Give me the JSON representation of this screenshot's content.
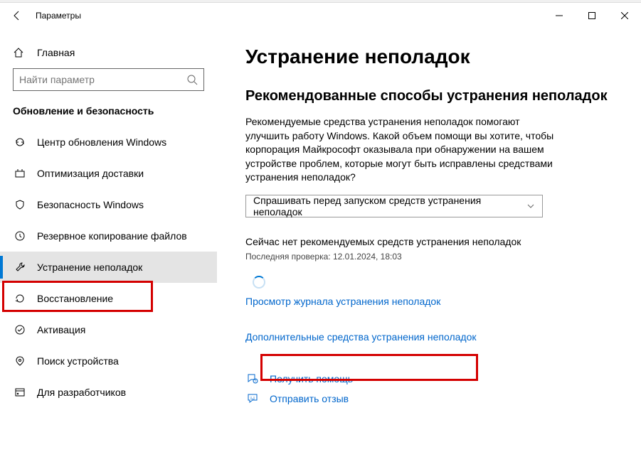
{
  "window": {
    "title": "Параметры"
  },
  "sidebar": {
    "home": "Главная",
    "search_placeholder": "Найти параметр",
    "category": "Обновление и безопасность",
    "items": [
      {
        "label": "Центр обновления Windows"
      },
      {
        "label": "Оптимизация доставки"
      },
      {
        "label": "Безопасность Windows"
      },
      {
        "label": "Резервное копирование файлов"
      },
      {
        "label": "Устранение неполадок"
      },
      {
        "label": "Восстановление"
      },
      {
        "label": "Активация"
      },
      {
        "label": "Поиск устройства"
      },
      {
        "label": "Для разработчиков"
      }
    ]
  },
  "main": {
    "title": "Устранение неполадок",
    "subtitle": "Рекомендованные способы устранения неполадок",
    "description": "Рекомендуемые средства устранения неполадок помогают улучшить работу Windows. Какой объем помощи вы хотите, чтобы корпорация Майкрософт оказывала при обнаружении на вашем устройстве проблем, которые могут быть исправлены средствами устранения неполадок?",
    "dropdown_value": "Спрашивать перед запуском средств устранения неполадок",
    "status": "Сейчас нет рекомендуемых средств устранения неполадок",
    "last_check": "Последняя проверка: 12.01.2024, 18:03",
    "history_link": "Просмотр журнала устранения неполадок",
    "additional_link": "Дополнительные средства устранения неполадок",
    "get_help": "Получить помощь",
    "feedback": "Отправить отзыв"
  }
}
